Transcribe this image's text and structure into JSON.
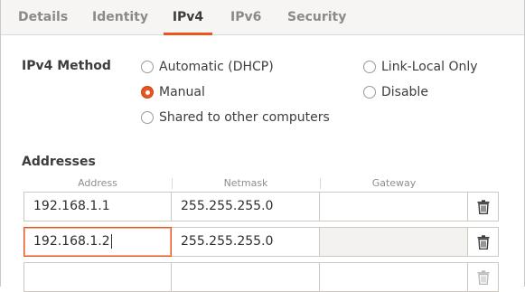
{
  "tabs": [
    {
      "label": "Details"
    },
    {
      "label": "Identity"
    },
    {
      "label": "IPv4"
    },
    {
      "label": "IPv6"
    },
    {
      "label": "Security"
    }
  ],
  "active_tab": "IPv4",
  "method": {
    "label": "IPv4 Method",
    "options": {
      "automatic": "Automatic (DHCP)",
      "manual": "Manual",
      "shared": "Shared to other computers",
      "link_local": "Link-Local Only",
      "disable": "Disable"
    },
    "selected": "Manual"
  },
  "addresses": {
    "label": "Addresses",
    "columns": {
      "address": "Address",
      "netmask": "Netmask",
      "gateway": "Gateway"
    },
    "rows": [
      {
        "address": "192.168.1.1",
        "netmask": "255.255.255.0",
        "gateway": ""
      },
      {
        "address": "192.168.1.2",
        "netmask": "255.255.255.0",
        "gateway": ""
      },
      {
        "address": "",
        "netmask": "",
        "gateway": ""
      }
    ]
  },
  "icons": {
    "delete": "trash-icon"
  },
  "colors": {
    "accent": "#e95420"
  }
}
